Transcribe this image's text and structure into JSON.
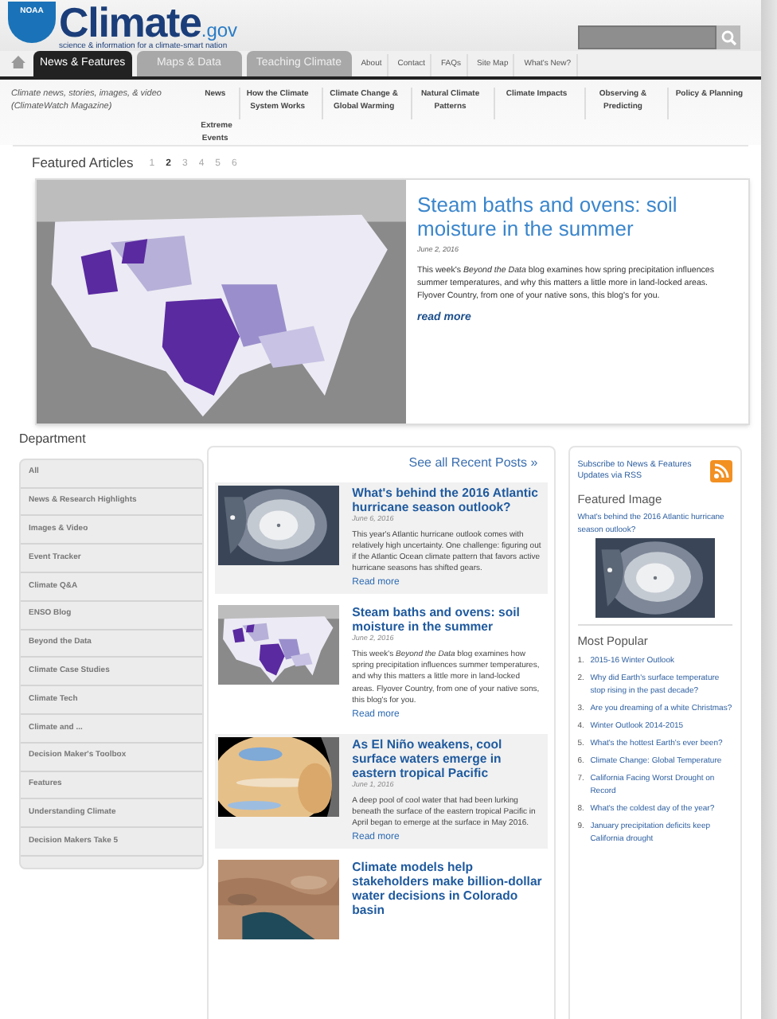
{
  "header": {
    "badge": "NOAA",
    "logo": "Climate",
    "logo_suffix": ".gov",
    "tagline": "science & information for a climate-smart nation"
  },
  "nav_tabs": [
    {
      "label": "News & Features",
      "kind": "tab",
      "selected": true
    },
    {
      "label": "Maps & Data",
      "kind": "tab",
      "selected": false
    },
    {
      "label": "Teaching Climate",
      "kind": "tab",
      "selected": false
    },
    {
      "label": "About",
      "kind": "link",
      "selected": false
    },
    {
      "label": "Contact",
      "kind": "link",
      "selected": false
    },
    {
      "label": "FAQs",
      "kind": "link",
      "selected": false
    },
    {
      "label": "Site Map",
      "kind": "link",
      "selected": false
    },
    {
      "label": "What's New?",
      "kind": "link",
      "selected": false
    }
  ],
  "subnav": {
    "description": "Climate news, stories, images, & video (ClimateWatch Magazine)",
    "items": [
      "News",
      "How the Climate System Works",
      "Climate Change & Global Warming",
      "Natural Climate Patterns",
      "Climate Impacts",
      "Observing & Predicting",
      "Policy & Planning"
    ],
    "extra": "Extreme Events"
  },
  "featured": {
    "heading": "Featured Articles",
    "pages": [
      {
        "label": "1",
        "selected": false
      },
      {
        "label": "2",
        "selected": true
      },
      {
        "label": "3",
        "selected": false
      },
      {
        "label": "4",
        "selected": false
      },
      {
        "label": "5",
        "selected": false
      },
      {
        "label": "6",
        "selected": false
      }
    ],
    "article": {
      "title": "Steam baths and ovens: soil moisture in the summer",
      "date": "June 2, 2016",
      "body": "This week's *Beyond the Data* blog examines how spring precipitation influences summer temperatures, and why this matters a little more in land-locked areas. Flyover Country, from one of your native sons, this blog's for you.",
      "read_more": "read more"
    }
  },
  "department": {
    "heading": "Department",
    "items": [
      "All",
      "News & Research Highlights",
      "Images & Video",
      "Event Tracker",
      "Climate Q&A",
      "ENSO Blog",
      "Beyond the Data",
      "Climate Case Studies",
      "Climate Tech",
      "Climate and ...",
      "Decision Maker's Toolbox",
      "Features",
      "Understanding Climate",
      "Decision Makers Take 5"
    ]
  },
  "recent": {
    "see_all": "See all Recent Posts »",
    "posts": [
      {
        "title": "What's behind the 2016 Atlantic hurricane season outlook?",
        "date": "June 6, 2016",
        "body": "This year's Atlantic hurricane outlook comes with relatively high uncertainty. One challenge: figuring out if the Atlantic Ocean climate pattern that favors active hurricane seasons has shifted gears.",
        "read_more": "Read more",
        "shaded": true
      },
      {
        "title": "Steam baths and ovens: soil moisture in the summer",
        "date": "June 2, 2016",
        "body": "This week's *Beyond the Data* blog examines how spring precipitation influences summer temperatures, and why this matters a little more in land-locked areas. Flyover Country, from one of your native sons, this blog's for you.",
        "read_more": "Read more",
        "shaded": false
      },
      {
        "title": "As El Niño weakens, cool surface waters emerge in eastern tropical Pacific",
        "date": "June 1, 2016",
        "body": "A deep pool of cool water that had been lurking beneath the surface of the eastern tropical Pacific in April began to emerge at the surface in May 2016.",
        "read_more": "Read more",
        "shaded": true
      },
      {
        "title": "Climate models help stakeholders make billion-dollar water decisions in Colorado basin",
        "shaded": false
      }
    ]
  },
  "sidebar": {
    "subscribe": "Subscribe to News & Features Updates via RSS",
    "featured_heading": "Featured Image",
    "featured_caption": "What's behind the 2016 Atlantic hurricane season outlook?",
    "popular_heading": "Most Popular",
    "popular": [
      {
        "num": "1.",
        "label": "2015-16 Winter Outlook"
      },
      {
        "num": "2.",
        "label": "Why did Earth's surface temperature stop rising in the past decade?"
      },
      {
        "num": "3.",
        "label": "Are you dreaming of a white Christmas?"
      },
      {
        "num": "4.",
        "label": "Winter Outlook 2014-2015"
      },
      {
        "num": "5.",
        "label": "What's the hottest Earth's ever been?"
      },
      {
        "num": "6.",
        "label": "Climate Change: Global Temperature"
      },
      {
        "num": "7.",
        "label": "California Facing Worst Drought on Record"
      },
      {
        "num": "8.",
        "label": "What's the coldest day of the year?"
      },
      {
        "num": "9.",
        "label": "January precipitation deficits keep California drought"
      }
    ]
  }
}
